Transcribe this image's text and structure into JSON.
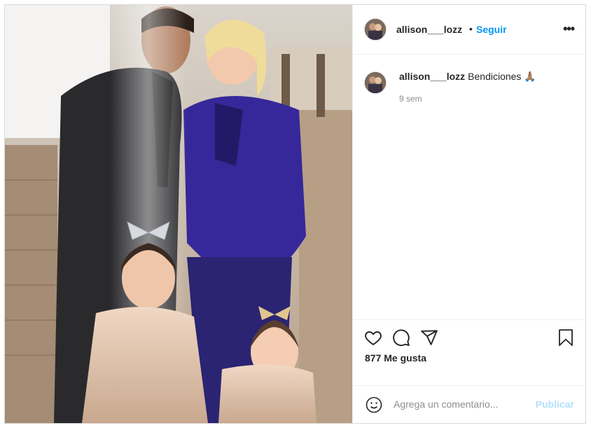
{
  "post": {
    "image_alt": "Family photo",
    "author": {
      "username": "allison___lozz",
      "follow_label": "Seguir",
      "separator": "•"
    },
    "more_icon": "more-horizontal-icon",
    "caption": {
      "username": "allison___lozz",
      "text": "Bendiciones 🙏🏽",
      "time_ago": "9 sem"
    },
    "actions": {
      "like_icon": "heart-icon",
      "comment_icon": "comment-icon",
      "share_icon": "paper-plane-icon",
      "save_icon": "bookmark-icon"
    },
    "likes_text": "877 Me gusta",
    "comment_box": {
      "emoji_icon": "smiley-icon",
      "placeholder": "Agrega un comentario...",
      "submit_label": "Publicar"
    }
  },
  "colors": {
    "accent": "#0095f6",
    "accent_disabled": "#b2dffc",
    "border": "#dbdbdb",
    "muted_text": "#8e8e8e"
  }
}
